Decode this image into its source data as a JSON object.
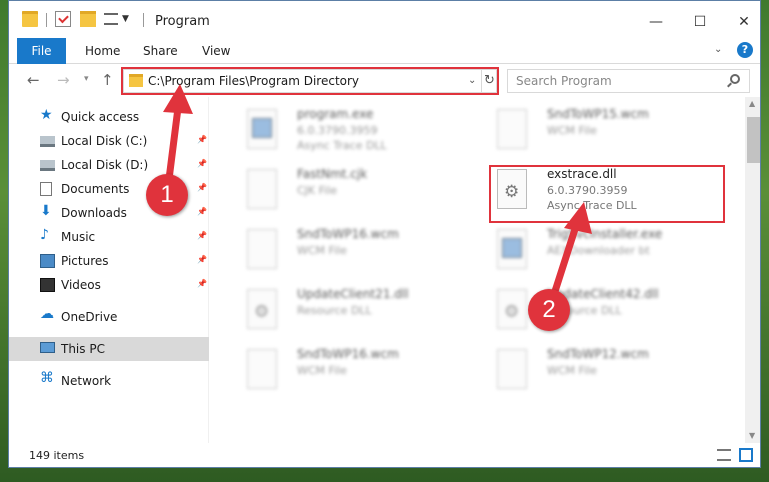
{
  "window": {
    "title": "Program",
    "controls": {
      "minimize": "—",
      "maximize": "☐",
      "close": "✕"
    }
  },
  "ribbon": {
    "tabs": [
      "File",
      "Home",
      "Share",
      "View"
    ],
    "help": "?"
  },
  "nav": {
    "address": "C:\\Program Files\\Program Directory",
    "search_placeholder": "Search Program"
  },
  "sidebar": {
    "items": [
      {
        "label": "Quick access",
        "icon": "star-icon",
        "pinned": false
      },
      {
        "label": "Local Disk (C:)",
        "icon": "disk-icon",
        "pinned": true
      },
      {
        "label": "Local Disk (D:)",
        "icon": "disk-icon",
        "pinned": true
      },
      {
        "label": "Documents",
        "icon": "document-icon",
        "pinned": true
      },
      {
        "label": "Downloads",
        "icon": "download-icon",
        "pinned": true
      },
      {
        "label": "Music",
        "icon": "music-icon",
        "pinned": true
      },
      {
        "label": "Pictures",
        "icon": "pictures-icon",
        "pinned": true
      },
      {
        "label": "Videos",
        "icon": "videos-icon",
        "pinned": true
      },
      {
        "label": "OneDrive",
        "icon": "cloud-icon",
        "pinned": false
      },
      {
        "label": "This PC",
        "icon": "computer-icon",
        "pinned": false,
        "selected": true
      },
      {
        "label": "Network",
        "icon": "network-icon",
        "pinned": false
      }
    ]
  },
  "files": [
    {
      "name": "program.exe",
      "line1": "6.0.3790.3959",
      "line2": "Async Trace DLL",
      "icon": "exe-icon",
      "blurred": true
    },
    {
      "name": "SndToWP15.wcm",
      "line1": "WCM File",
      "line2": "",
      "icon": "file-icon",
      "blurred": true
    },
    {
      "name": "FastNmt.cjk",
      "line1": "CJK File",
      "line2": "",
      "icon": "file-icon",
      "blurred": true
    },
    {
      "name": "exstrace.dll",
      "line1": "6.0.3790.3959",
      "line2": "Async Trace DLL",
      "icon": "dll-icon",
      "blurred": false,
      "highlighted": true
    },
    {
      "name": "SndToWP16.wcm",
      "line1": "WCM File",
      "line2": "",
      "icon": "file-icon",
      "blurred": true
    },
    {
      "name": "TrigSvcInstaller.exe",
      "line1": "AEXDownloader bt",
      "line2": "",
      "icon": "exe-icon",
      "blurred": true
    },
    {
      "name": "UpdateClient21.dll",
      "line1": "Resource DLL",
      "line2": "",
      "icon": "dll-icon",
      "blurred": true
    },
    {
      "name": "UpdateClient42.dll",
      "line1": "Resource DLL",
      "line2": "",
      "icon": "dll-icon",
      "blurred": true
    },
    {
      "name": "SndToWP16.wcm",
      "line1": "WCM File",
      "line2": "",
      "icon": "file-icon",
      "blurred": true
    },
    {
      "name": "SndToWP12.wcm",
      "line1": "WCM File",
      "line2": "",
      "icon": "file-icon",
      "blurred": true
    }
  ],
  "status": {
    "count": "149 items"
  },
  "callouts": [
    "1",
    "2"
  ],
  "colors": {
    "accent": "#1979ca",
    "highlight": "#e0333c"
  }
}
